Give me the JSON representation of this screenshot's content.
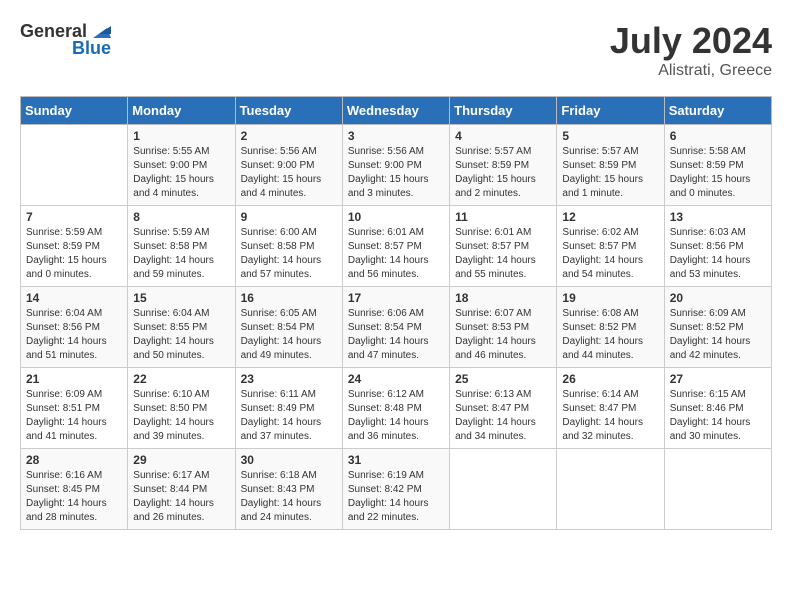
{
  "logo": {
    "general": "General",
    "blue": "Blue"
  },
  "title": {
    "month_year": "July 2024",
    "location": "Alistrati, Greece"
  },
  "weekdays": [
    "Sunday",
    "Monday",
    "Tuesday",
    "Wednesday",
    "Thursday",
    "Friday",
    "Saturday"
  ],
  "weeks": [
    [
      {
        "day": "",
        "lines": []
      },
      {
        "day": "1",
        "lines": [
          "Sunrise: 5:55 AM",
          "Sunset: 9:00 PM",
          "Daylight: 15 hours",
          "and 4 minutes."
        ]
      },
      {
        "day": "2",
        "lines": [
          "Sunrise: 5:56 AM",
          "Sunset: 9:00 PM",
          "Daylight: 15 hours",
          "and 4 minutes."
        ]
      },
      {
        "day": "3",
        "lines": [
          "Sunrise: 5:56 AM",
          "Sunset: 9:00 PM",
          "Daylight: 15 hours",
          "and 3 minutes."
        ]
      },
      {
        "day": "4",
        "lines": [
          "Sunrise: 5:57 AM",
          "Sunset: 8:59 PM",
          "Daylight: 15 hours",
          "and 2 minutes."
        ]
      },
      {
        "day": "5",
        "lines": [
          "Sunrise: 5:57 AM",
          "Sunset: 8:59 PM",
          "Daylight: 15 hours",
          "and 1 minute."
        ]
      },
      {
        "day": "6",
        "lines": [
          "Sunrise: 5:58 AM",
          "Sunset: 8:59 PM",
          "Daylight: 15 hours",
          "and 0 minutes."
        ]
      }
    ],
    [
      {
        "day": "7",
        "lines": [
          "Sunrise: 5:59 AM",
          "Sunset: 8:59 PM",
          "Daylight: 15 hours",
          "and 0 minutes."
        ]
      },
      {
        "day": "8",
        "lines": [
          "Sunrise: 5:59 AM",
          "Sunset: 8:58 PM",
          "Daylight: 14 hours",
          "and 59 minutes."
        ]
      },
      {
        "day": "9",
        "lines": [
          "Sunrise: 6:00 AM",
          "Sunset: 8:58 PM",
          "Daylight: 14 hours",
          "and 57 minutes."
        ]
      },
      {
        "day": "10",
        "lines": [
          "Sunrise: 6:01 AM",
          "Sunset: 8:57 PM",
          "Daylight: 14 hours",
          "and 56 minutes."
        ]
      },
      {
        "day": "11",
        "lines": [
          "Sunrise: 6:01 AM",
          "Sunset: 8:57 PM",
          "Daylight: 14 hours",
          "and 55 minutes."
        ]
      },
      {
        "day": "12",
        "lines": [
          "Sunrise: 6:02 AM",
          "Sunset: 8:57 PM",
          "Daylight: 14 hours",
          "and 54 minutes."
        ]
      },
      {
        "day": "13",
        "lines": [
          "Sunrise: 6:03 AM",
          "Sunset: 8:56 PM",
          "Daylight: 14 hours",
          "and 53 minutes."
        ]
      }
    ],
    [
      {
        "day": "14",
        "lines": [
          "Sunrise: 6:04 AM",
          "Sunset: 8:56 PM",
          "Daylight: 14 hours",
          "and 51 minutes."
        ]
      },
      {
        "day": "15",
        "lines": [
          "Sunrise: 6:04 AM",
          "Sunset: 8:55 PM",
          "Daylight: 14 hours",
          "and 50 minutes."
        ]
      },
      {
        "day": "16",
        "lines": [
          "Sunrise: 6:05 AM",
          "Sunset: 8:54 PM",
          "Daylight: 14 hours",
          "and 49 minutes."
        ]
      },
      {
        "day": "17",
        "lines": [
          "Sunrise: 6:06 AM",
          "Sunset: 8:54 PM",
          "Daylight: 14 hours",
          "and 47 minutes."
        ]
      },
      {
        "day": "18",
        "lines": [
          "Sunrise: 6:07 AM",
          "Sunset: 8:53 PM",
          "Daylight: 14 hours",
          "and 46 minutes."
        ]
      },
      {
        "day": "19",
        "lines": [
          "Sunrise: 6:08 AM",
          "Sunset: 8:52 PM",
          "Daylight: 14 hours",
          "and 44 minutes."
        ]
      },
      {
        "day": "20",
        "lines": [
          "Sunrise: 6:09 AM",
          "Sunset: 8:52 PM",
          "Daylight: 14 hours",
          "and 42 minutes."
        ]
      }
    ],
    [
      {
        "day": "21",
        "lines": [
          "Sunrise: 6:09 AM",
          "Sunset: 8:51 PM",
          "Daylight: 14 hours",
          "and 41 minutes."
        ]
      },
      {
        "day": "22",
        "lines": [
          "Sunrise: 6:10 AM",
          "Sunset: 8:50 PM",
          "Daylight: 14 hours",
          "and 39 minutes."
        ]
      },
      {
        "day": "23",
        "lines": [
          "Sunrise: 6:11 AM",
          "Sunset: 8:49 PM",
          "Daylight: 14 hours",
          "and 37 minutes."
        ]
      },
      {
        "day": "24",
        "lines": [
          "Sunrise: 6:12 AM",
          "Sunset: 8:48 PM",
          "Daylight: 14 hours",
          "and 36 minutes."
        ]
      },
      {
        "day": "25",
        "lines": [
          "Sunrise: 6:13 AM",
          "Sunset: 8:47 PM",
          "Daylight: 14 hours",
          "and 34 minutes."
        ]
      },
      {
        "day": "26",
        "lines": [
          "Sunrise: 6:14 AM",
          "Sunset: 8:47 PM",
          "Daylight: 14 hours",
          "and 32 minutes."
        ]
      },
      {
        "day": "27",
        "lines": [
          "Sunrise: 6:15 AM",
          "Sunset: 8:46 PM",
          "Daylight: 14 hours",
          "and 30 minutes."
        ]
      }
    ],
    [
      {
        "day": "28",
        "lines": [
          "Sunrise: 6:16 AM",
          "Sunset: 8:45 PM",
          "Daylight: 14 hours",
          "and 28 minutes."
        ]
      },
      {
        "day": "29",
        "lines": [
          "Sunrise: 6:17 AM",
          "Sunset: 8:44 PM",
          "Daylight: 14 hours",
          "and 26 minutes."
        ]
      },
      {
        "day": "30",
        "lines": [
          "Sunrise: 6:18 AM",
          "Sunset: 8:43 PM",
          "Daylight: 14 hours",
          "and 24 minutes."
        ]
      },
      {
        "day": "31",
        "lines": [
          "Sunrise: 6:19 AM",
          "Sunset: 8:42 PM",
          "Daylight: 14 hours",
          "and 22 minutes."
        ]
      },
      {
        "day": "",
        "lines": []
      },
      {
        "day": "",
        "lines": []
      },
      {
        "day": "",
        "lines": []
      }
    ]
  ]
}
